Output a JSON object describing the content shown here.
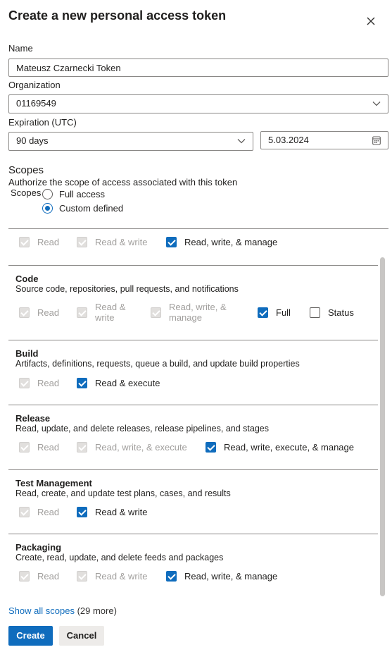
{
  "dialog": {
    "title": "Create a new personal access token"
  },
  "form": {
    "name_label": "Name",
    "name_value": "Mateusz Czarnecki Token",
    "org_label": "Organization",
    "org_value": "01169549",
    "expiration_label": "Expiration (UTC)",
    "expiration_value": "90 days",
    "expiration_date": "5.03.2024"
  },
  "scopes": {
    "heading": "Scopes",
    "subtitle": "Authorize the scope of access associated with this token",
    "label": "Scopes",
    "options": [
      {
        "label": "Full access",
        "selected": false
      },
      {
        "label": "Custom defined",
        "selected": true
      }
    ]
  },
  "groups": [
    {
      "title": "",
      "description": "",
      "options": [
        {
          "label": "Read",
          "state": "disabled"
        },
        {
          "label": "Read & write",
          "state": "disabled"
        },
        {
          "label": "Read, write, & manage",
          "state": "checked"
        }
      ]
    },
    {
      "title": "Code",
      "description": "Source code, repositories, pull requests, and notifications",
      "options": [
        {
          "label": "Read",
          "state": "disabled"
        },
        {
          "label": "Read &",
          "label2": "write",
          "state": "disabled"
        },
        {
          "label": "Read, write, &",
          "label2": "manage",
          "state": "disabled"
        },
        {
          "label": "Full",
          "state": "checked"
        },
        {
          "label": "Status",
          "state": "empty"
        }
      ]
    },
    {
      "title": "Build",
      "description": "Artifacts, definitions, requests, queue a build, and update build properties",
      "options": [
        {
          "label": "Read",
          "state": "disabled"
        },
        {
          "label": "Read & execute",
          "state": "checked"
        }
      ]
    },
    {
      "title": "Release",
      "description": "Read, update, and delete releases, release pipelines, and stages",
      "options": [
        {
          "label": "Read",
          "state": "disabled"
        },
        {
          "label": "Read, write, & execute",
          "state": "disabled"
        },
        {
          "label": "Read, write, execute, & manage",
          "state": "checked"
        }
      ]
    },
    {
      "title": "Test Management",
      "description": "Read, create, and update test plans, cases, and results",
      "options": [
        {
          "label": "Read",
          "state": "disabled"
        },
        {
          "label": "Read & write",
          "state": "checked"
        }
      ]
    },
    {
      "title": "Packaging",
      "description": "Create, read, update, and delete feeds and packages",
      "options": [
        {
          "label": "Read",
          "state": "disabled"
        },
        {
          "label": "Read & write",
          "state": "disabled"
        },
        {
          "label": "Read, write, & manage",
          "state": "checked"
        }
      ]
    }
  ],
  "footer": {
    "show_all_link": "Show all scopes",
    "show_all_count": "(29 more)",
    "create_label": "Create",
    "cancel_label": "Cancel"
  },
  "colors": {
    "accent": "#0f6cbd",
    "border": "#8a8886",
    "disabled_text": "#a19f9d"
  }
}
